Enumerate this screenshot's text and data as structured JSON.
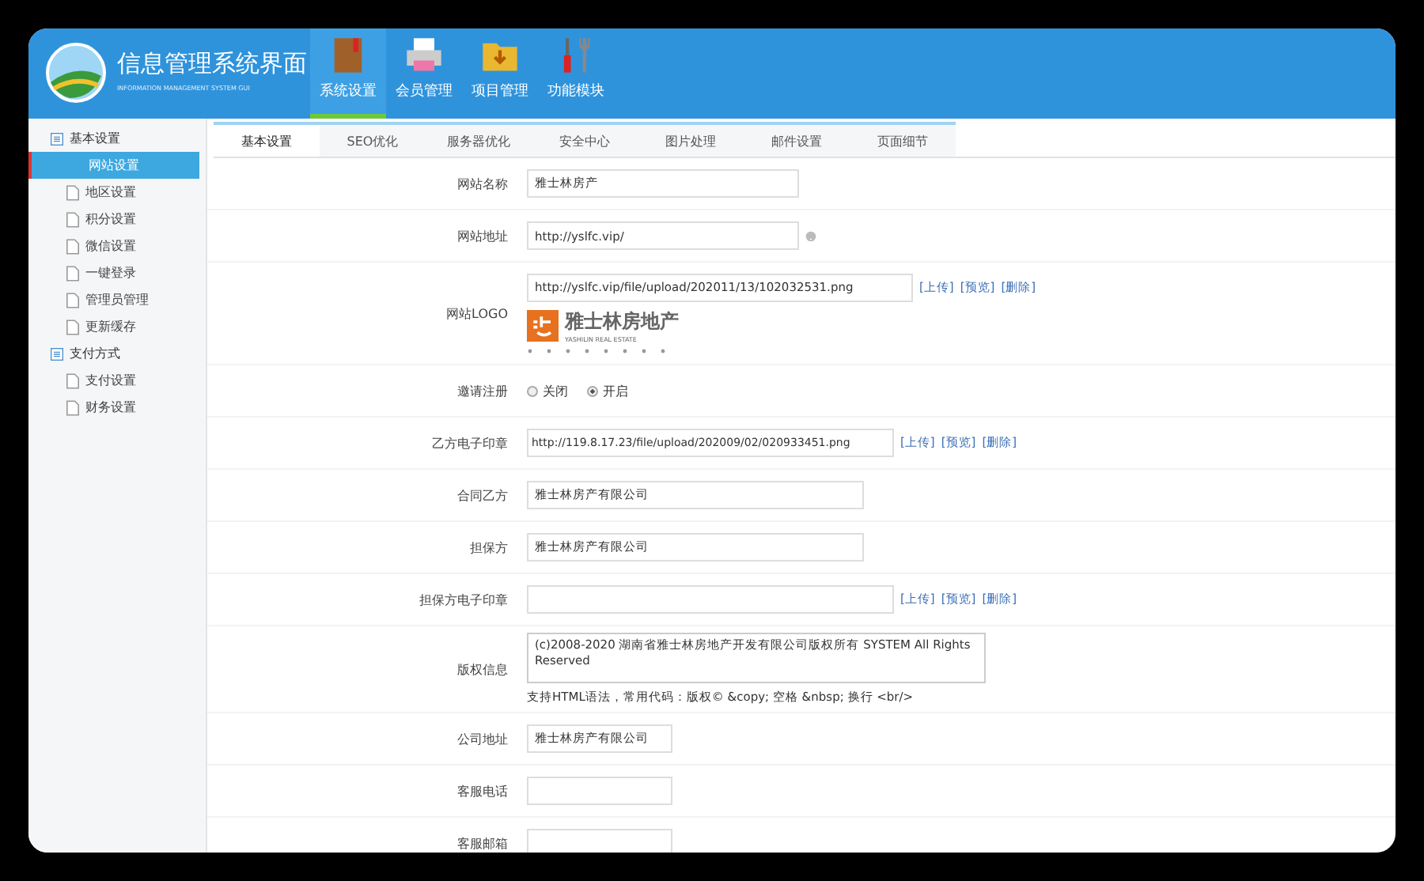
{
  "header": {
    "title": "信息管理系统界面",
    "subtitle": "INFORMATION MANAGEMENT SYSTEM GUI",
    "nav": [
      {
        "label": "系统设置",
        "selected": true
      },
      {
        "label": "会员管理",
        "selected": false
      },
      {
        "label": "项目管理",
        "selected": false
      },
      {
        "label": "功能模块",
        "selected": false
      }
    ]
  },
  "sidebar": {
    "groups": [
      {
        "label": "基本设置",
        "children": [
          {
            "label": "网站设置",
            "selected": true
          },
          {
            "label": "地区设置",
            "selected": false
          },
          {
            "label": "积分设置",
            "selected": false
          },
          {
            "label": "微信设置",
            "selected": false
          },
          {
            "label": "一键登录",
            "selected": false
          },
          {
            "label": "管理员管理",
            "selected": false
          },
          {
            "label": "更新缓存",
            "selected": false
          }
        ]
      },
      {
        "label": "支付方式",
        "children": [
          {
            "label": "支付设置",
            "selected": false
          },
          {
            "label": "财务设置",
            "selected": false
          }
        ]
      }
    ]
  },
  "tabs": [
    {
      "label": "基本设置",
      "selected": true
    },
    {
      "label": "SEO优化",
      "selected": false
    },
    {
      "label": "服务器优化",
      "selected": false
    },
    {
      "label": "安全中心",
      "selected": false
    },
    {
      "label": "图片处理",
      "selected": false
    },
    {
      "label": "邮件设置",
      "selected": false
    },
    {
      "label": "页面细节",
      "selected": false
    }
  ],
  "form": [
    {
      "kind": "text",
      "label": "网站名称",
      "value": "雅士林房产"
    },
    {
      "kind": "text",
      "label": "网站地址",
      "value": "http://yslfc.vip/",
      "help": true
    },
    {
      "kind": "logo",
      "label": "网站LOGO",
      "value": "http://yslfc.vip/file/upload/202011/13/102032531.png",
      "links": [
        "[上传]",
        "[预览]",
        "[删除]"
      ],
      "logo_title": "雅士林房地产",
      "logo_subtitle": "YASHILIN REAL ESTATE"
    },
    {
      "kind": "radio",
      "label": "邀请注册",
      "options": [
        {
          "label": "关闭",
          "selected": false
        },
        {
          "label": "开启",
          "selected": true
        }
      ]
    },
    {
      "kind": "upload",
      "label": "乙方电子印章",
      "value": "http://119.8.17.23/file/upload/202009/02/020933451.png",
      "links": [
        "[上传]",
        "[预览]",
        "[删除]"
      ]
    },
    {
      "kind": "wide",
      "label": "合同乙方",
      "value": "雅士林房产有限公司"
    },
    {
      "kind": "wide",
      "label": "担保方",
      "value": "雅士林房产有限公司"
    },
    {
      "kind": "upload",
      "label": "担保方电子印章",
      "links": [
        "[上传]",
        "[预览]",
        "[删除]"
      ]
    },
    {
      "kind": "textarea",
      "label": "版权信息",
      "value": "(c)2008-2020 湖南省雅士林房地产开发有限公司版权所有 SYSTEM All Rights Reserved",
      "hint": "支持HTML语法，常用代码：版权© &copy; 空格 &nbsp; 换行 <br/>"
    },
    {
      "kind": "short",
      "label": "公司地址",
      "value": "雅士林房产有限公司"
    },
    {
      "kind": "short",
      "label": "客服电话"
    },
    {
      "kind": "short",
      "label": "客服邮箱"
    }
  ]
}
